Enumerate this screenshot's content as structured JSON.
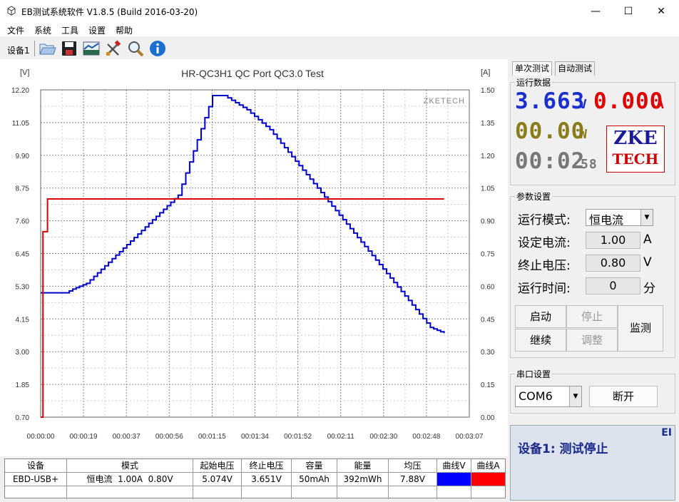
{
  "window": {
    "title": "EB测试系统软件 V1.8.5 (Build 2016-03-20)",
    "minimize": "—",
    "maximize": "☐",
    "close": "✕"
  },
  "menu": [
    "文件",
    "系统",
    "工具",
    "设置",
    "帮助"
  ],
  "toolbar": {
    "device_label": "设备1",
    "icons": [
      "open-icon",
      "save-icon",
      "chart-image-icon",
      "tools-icon",
      "search-icon",
      "info-icon"
    ]
  },
  "chart_data": {
    "type": "line",
    "title": "HR-QC3H1 QC Port QC3.0 Test",
    "watermark": "ZKETECH",
    "ylabel_left": "[V]",
    "ylabel_right": "[A]",
    "y_left_ticks": [
      "12.20",
      "11.05",
      "9.90",
      "8.75",
      "7.60",
      "6.45",
      "5.30",
      "4.15",
      "3.00",
      "1.85",
      "0.70"
    ],
    "y_right_ticks": [
      "1.50",
      "1.35",
      "1.20",
      "1.05",
      "0.90",
      "0.75",
      "0.60",
      "0.45",
      "0.30",
      "0.15",
      "0.00"
    ],
    "x_ticks": [
      "00:00:00",
      "00:00:19",
      "00:00:37",
      "00:00:56",
      "00:01:15",
      "00:01:34",
      "00:01:52",
      "00:02:11",
      "00:02:30",
      "00:02:48",
      "00:03:07"
    ],
    "ylim_left": [
      0.7,
      12.2
    ],
    "ylim_right": [
      0,
      1.5
    ],
    "xlim_seconds": [
      0,
      187
    ],
    "grid": true,
    "series": [
      {
        "axis": "left",
        "color": "#0000cc",
        "x": [
          0,
          11,
          14,
          17,
          20,
          60,
          75,
          80,
          90,
          100,
          170,
          176
        ],
        "y": [
          5.07,
          5.07,
          5.2,
          5.3,
          5.4,
          8.5,
          12.0,
          12.0,
          11.5,
          10.8,
          3.85,
          3.65
        ]
      },
      {
        "axis": "right",
        "color": "#dd0000",
        "x": [
          0,
          1,
          1,
          3,
          3,
          176
        ],
        "y": [
          0,
          0,
          0.85,
          0.85,
          1.0,
          1.0
        ]
      }
    ]
  },
  "table": {
    "headers": [
      "设备",
      "模式",
      "起始电压",
      "终止电压",
      "容量",
      "能量",
      "均压",
      "曲线V",
      "曲线A"
    ],
    "row": [
      "EBD-USB+",
      "恒电流  1.00A  0.80V",
      "5.074V",
      "3.651V",
      "50mAh",
      "392mWh",
      "7.88V",
      "",
      ""
    ],
    "curve_colors": [
      "#0000ff",
      "#ff0000"
    ]
  },
  "right": {
    "tabs": [
      "单次测试",
      "自动测试"
    ],
    "run_data_label": "运行数据",
    "voltage": "3.663",
    "voltage_unit": "V",
    "current": "0.000",
    "current_unit": "A",
    "power": "00.00",
    "power_unit": "W",
    "time": "00:02",
    "seconds": "58",
    "logo_line1": "ZKE",
    "logo_line2": "TECH",
    "params_label": "参数设置",
    "mode_label": "运行模式:",
    "mode_value": "恒电流",
    "current_label": "设定电流:",
    "current_value": "1.00",
    "current_set_unit": "A",
    "cutoff_label": "终止电压:",
    "cutoff_value": "0.80",
    "cutoff_unit": "V",
    "runtime_label": "运行时间:",
    "runtime_value": "0",
    "runtime_unit": "分",
    "btn_start": "启动",
    "btn_stop": "停止",
    "btn_monitor": "监测",
    "btn_continue": "继续",
    "btn_adjust": "调整",
    "serial_label": "串口设置",
    "com_value": "COM6",
    "btn_disconnect": "断开",
    "status_text": "设备1: 测试停止",
    "status_corner": "EI"
  }
}
